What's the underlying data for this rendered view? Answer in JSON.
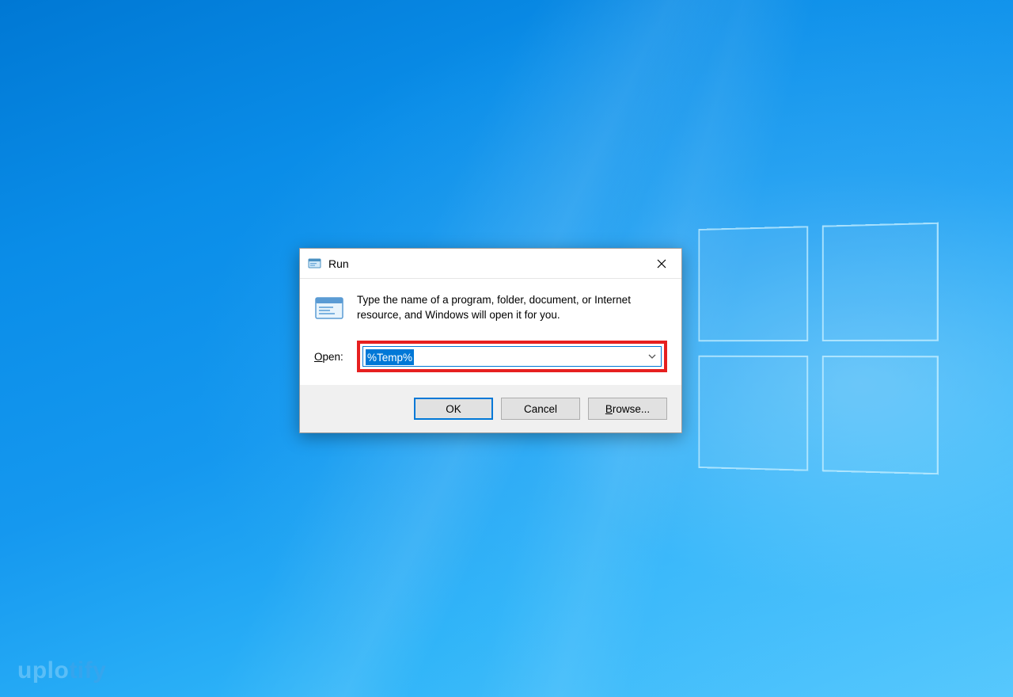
{
  "dialog": {
    "title": "Run",
    "description": "Type the name of a program, folder, document, or Internet resource, and Windows will open it for you.",
    "open_label_prefix": "O",
    "open_label_rest": "pen:",
    "input_value": "%Temp%",
    "buttons": {
      "ok": "OK",
      "cancel": "Cancel",
      "browse_prefix": "B",
      "browse_rest": "rowse..."
    }
  },
  "watermark": {
    "part1": "uplo",
    "part2": "tify"
  }
}
